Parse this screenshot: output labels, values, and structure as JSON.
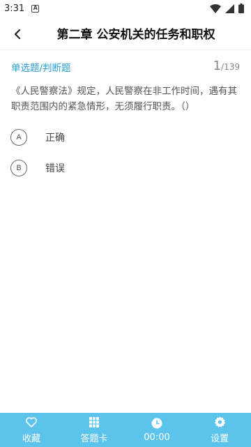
{
  "status_bar": {
    "time": "3:31",
    "a_glyph": "A"
  },
  "header": {
    "title": "第二章 公安机关的任务和职权"
  },
  "question": {
    "type": "单选题/判断题",
    "current": "1",
    "total": "/139",
    "text": "《人民警察法》规定，人民警察在非工作时间，遇有其职责范围内的紧急情形，无须履行职责。（）",
    "options": [
      {
        "letter": "A",
        "text": "正确"
      },
      {
        "letter": "B",
        "text": "错误"
      }
    ]
  },
  "bottom_bar": {
    "tabs": [
      {
        "label": "收藏",
        "icon": "heart-icon"
      },
      {
        "label": "答题卡",
        "icon": "grid-icon"
      },
      {
        "label": "00:00",
        "icon": "clock-icon"
      },
      {
        "label": "设置",
        "icon": "gear-icon"
      }
    ]
  },
  "colors": {
    "accent": "#2aa0d6",
    "bottom_bar": "#5cc3ec"
  }
}
